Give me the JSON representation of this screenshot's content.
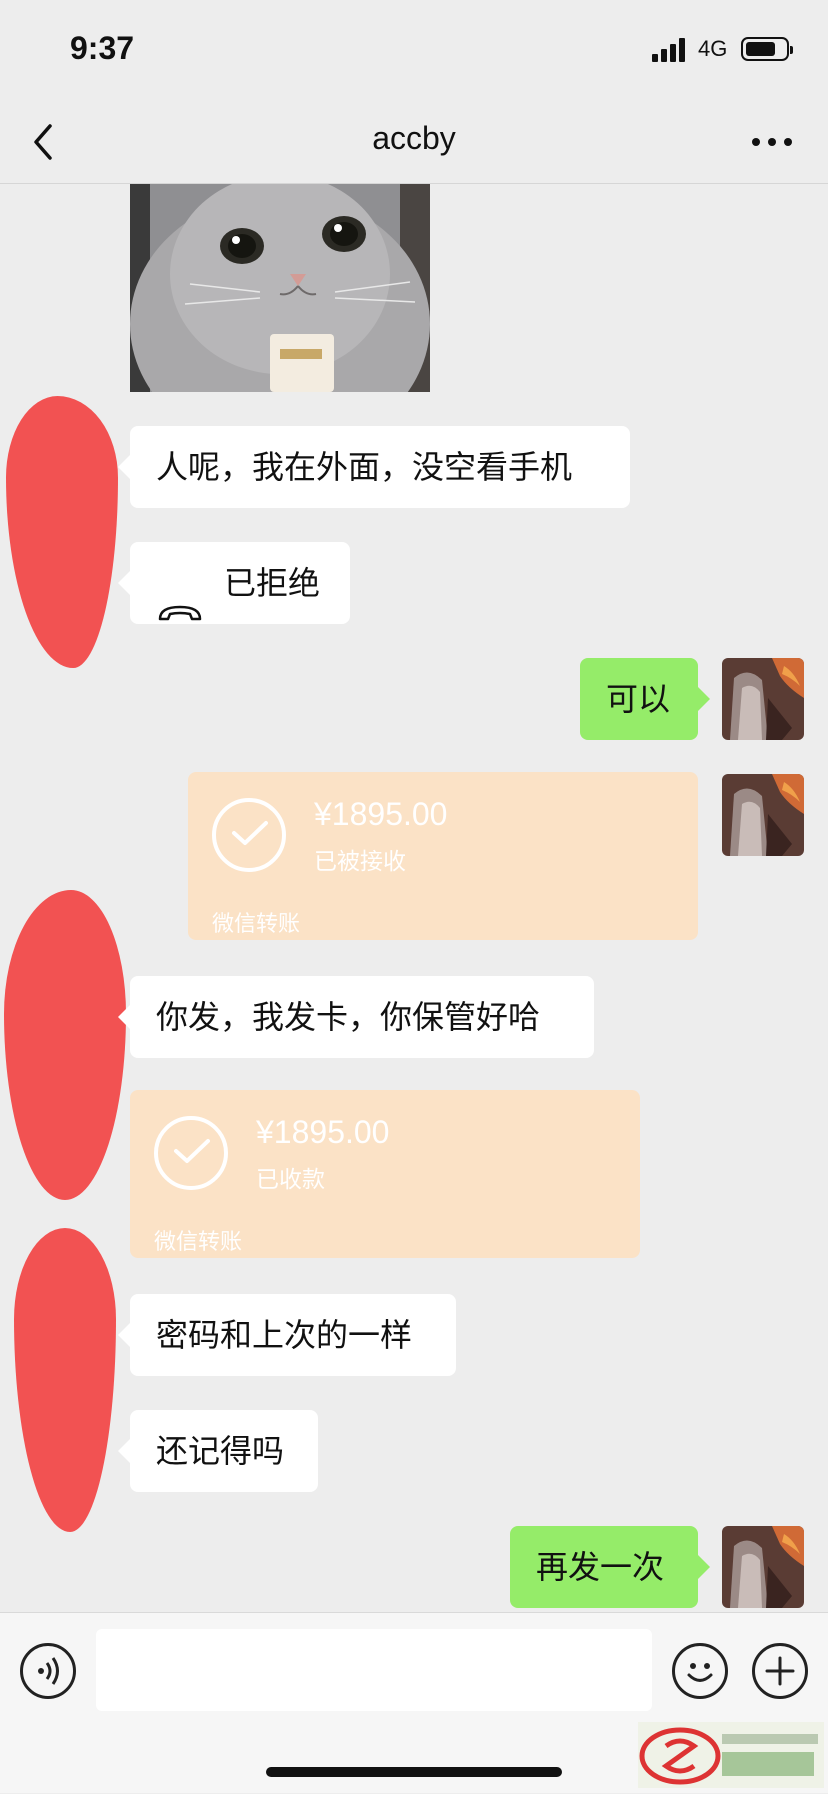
{
  "status_bar": {
    "time": "9:37",
    "network": "4G"
  },
  "header": {
    "title": "accby"
  },
  "messages": [
    {
      "side": "left",
      "type": "text",
      "text": "人呢，我在外面，没空看手机"
    },
    {
      "side": "left",
      "type": "call",
      "text": "已拒绝"
    },
    {
      "side": "right",
      "type": "text",
      "text": "可以"
    },
    {
      "side": "right",
      "type": "transfer",
      "amount": "¥1895.00",
      "status": "已被接收",
      "brand": "微信转账"
    },
    {
      "side": "left",
      "type": "text",
      "text": "你发，我发卡，你保管好哈"
    },
    {
      "side": "left",
      "type": "transfer",
      "amount": "¥1895.00",
      "status": "已收款",
      "brand": "微信转账"
    },
    {
      "side": "left",
      "type": "text",
      "text": "密码和上次的一样"
    },
    {
      "side": "left",
      "type": "text",
      "text": "还记得吗"
    },
    {
      "side": "right",
      "type": "text",
      "text": "再发一次"
    }
  ],
  "icons": {
    "back": "chevron-left-icon",
    "more": "ellipsis-icon",
    "voice": "voice-icon",
    "emoji": "emoji-icon",
    "plus": "plus-icon",
    "call": "phone-hangup-icon"
  },
  "colors": {
    "self_bubble": "#95ec69",
    "other_bubble": "#ffffff",
    "transfer_card": "#fbe2c6",
    "redaction": "#f25252"
  }
}
